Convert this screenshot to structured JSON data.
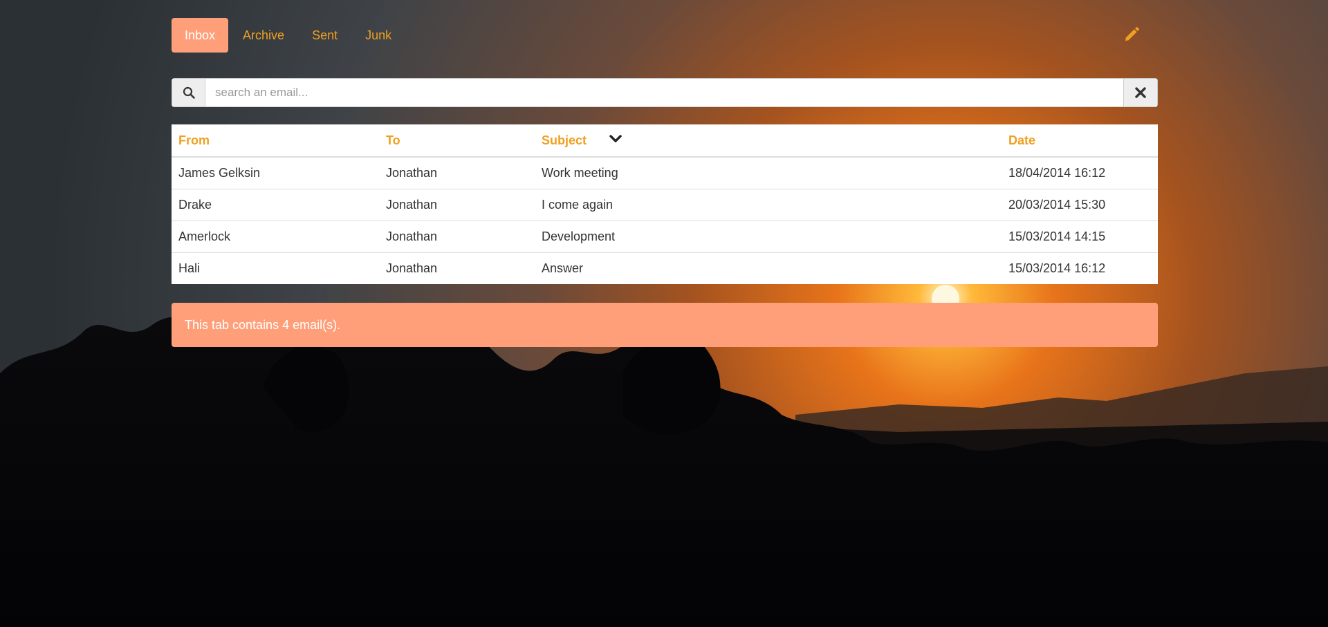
{
  "tabs": [
    {
      "label": "Inbox",
      "active": true
    },
    {
      "label": "Archive",
      "active": false
    },
    {
      "label": "Sent",
      "active": false
    },
    {
      "label": "Junk",
      "active": false
    }
  ],
  "compose": {
    "icon": "pencil-icon"
  },
  "search": {
    "placeholder": "search an email...",
    "value": "",
    "search_icon": "search-icon",
    "clear_icon": "close-icon"
  },
  "table": {
    "columns": [
      "From",
      "To",
      "Subject",
      "Date"
    ],
    "sort_icon": "chevron-down-icon",
    "rows": [
      {
        "from": "James Gelksin",
        "to": "Jonathan",
        "subject": "Work meeting",
        "date": "18/04/2014 16:12"
      },
      {
        "from": "Drake",
        "to": "Jonathan",
        "subject": "I come again",
        "date": "20/03/2014 15:30"
      },
      {
        "from": "Amerlock",
        "to": "Jonathan",
        "subject": "Development",
        "date": "15/03/2014 14:15"
      },
      {
        "from": "Hali",
        "to": "Jonathan",
        "subject": "Answer",
        "date": "15/03/2014 16:12"
      }
    ]
  },
  "alert": {
    "text": "This tab contains 4 email(s)."
  },
  "colors": {
    "accent": "#ff9f7a",
    "link": "#f0a020"
  }
}
